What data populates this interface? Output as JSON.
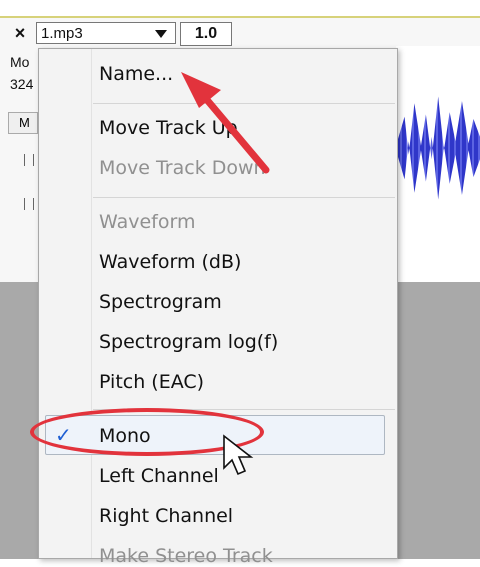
{
  "track_header": {
    "close_icon": "close-icon",
    "name_value": "1.mp3",
    "dropdown_icon": "chevron-down-icon",
    "rate_value": "1.0",
    "info_line_1": "Mo",
    "info_line_2": "324",
    "tab_label": "M"
  },
  "menu": {
    "items": [
      {
        "label": "Name...",
        "enabled": true
      },
      {
        "label": "Move Track Up",
        "enabled": true
      },
      {
        "label": "Move Track Down",
        "enabled": false
      },
      {
        "label": "Waveform",
        "enabled": false
      },
      {
        "label": "Waveform (dB)",
        "enabled": true
      },
      {
        "label": "Spectrogram",
        "enabled": true
      },
      {
        "label": "Spectrogram log(f)",
        "enabled": true
      },
      {
        "label": "Pitch (EAC)",
        "enabled": true
      },
      {
        "label": "Mono",
        "enabled": true,
        "checked": true
      },
      {
        "label": "Left Channel",
        "enabled": true
      },
      {
        "label": "Right Channel",
        "enabled": true
      },
      {
        "label": "Make Stereo Track",
        "enabled": false
      }
    ]
  },
  "annotations": {
    "arrow_color": "#e2333c",
    "ellipse_color": "#e2333c",
    "cursor_icon": "arrow-cursor-icon"
  },
  "colors": {
    "waveform": "#2f36c9",
    "check": "#1f5fd3",
    "menu_bg": "#f3f3f3"
  }
}
